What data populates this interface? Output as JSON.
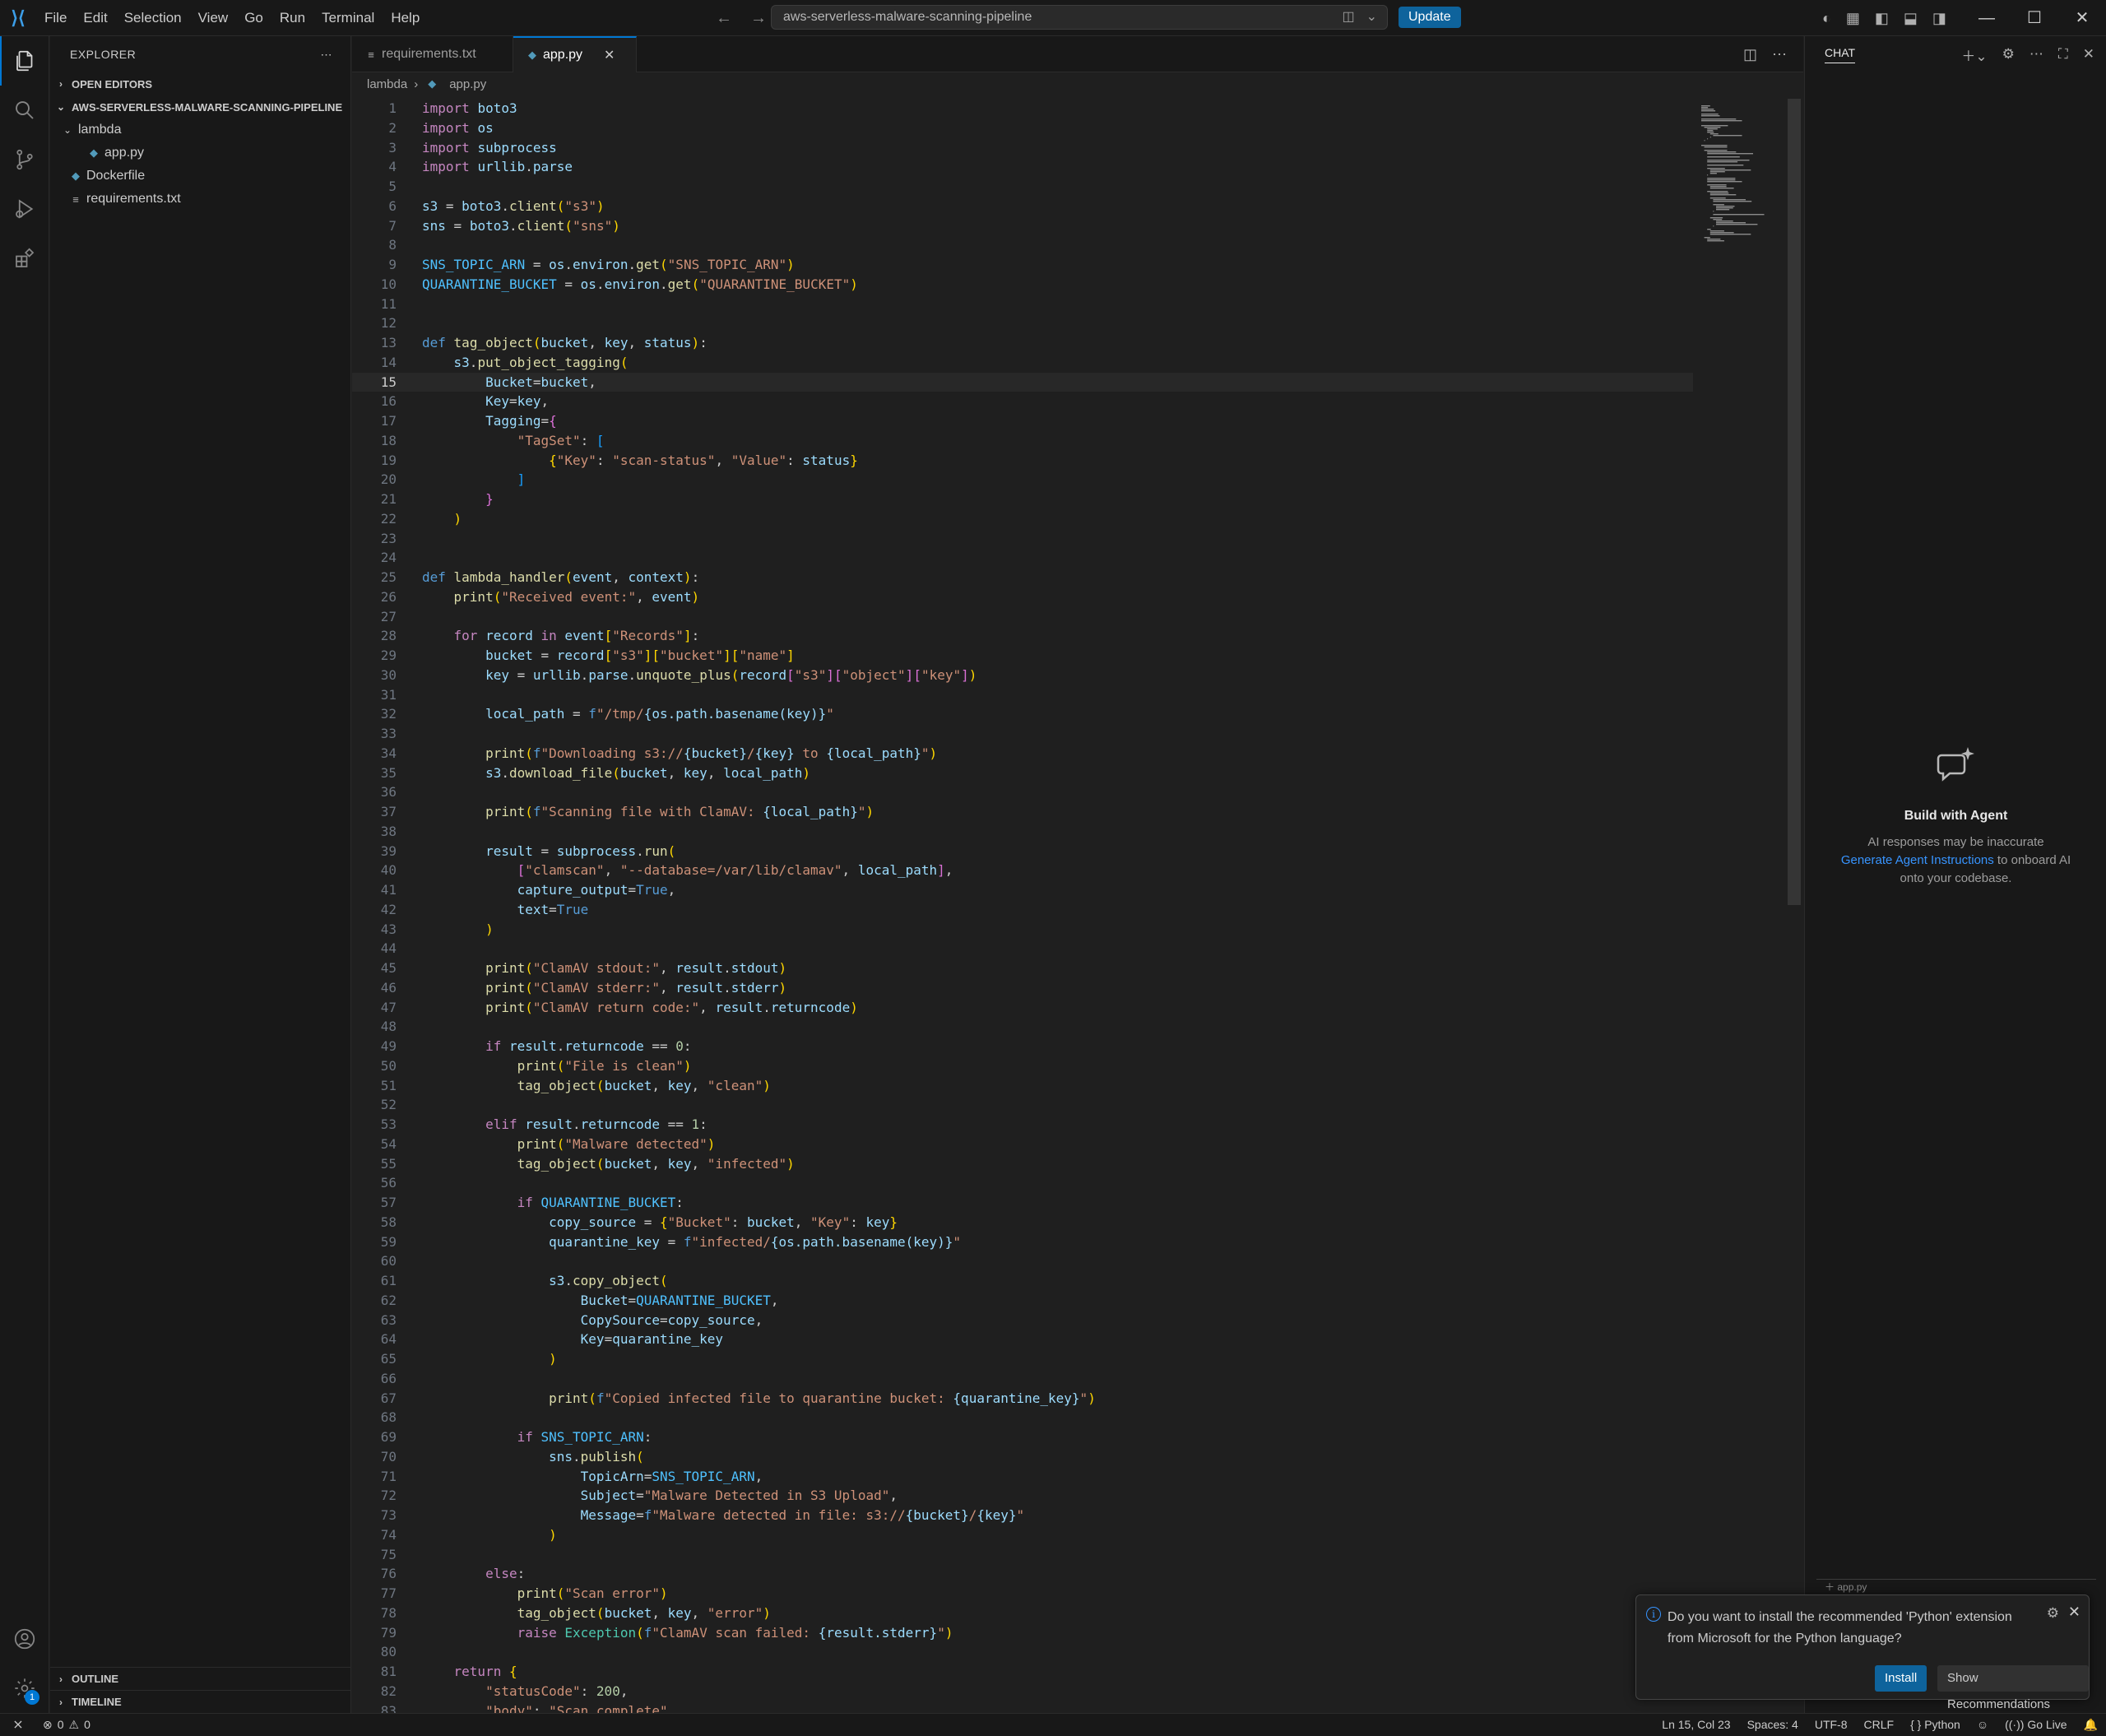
{
  "titlebar": {
    "menu": [
      "File",
      "Edit",
      "Selection",
      "View",
      "Go",
      "Run",
      "Terminal",
      "Help"
    ],
    "command_center": "aws-serverless-malware-scanning-pipeline",
    "update_label": "Update"
  },
  "activitybar": {
    "items": [
      "explorer-icon",
      "search-icon",
      "source-control-icon",
      "run-debug-icon",
      "extensions-icon"
    ],
    "settings_badge": "1"
  },
  "sidebar": {
    "header": "EXPLORER",
    "open_editors": "OPEN EDITORS",
    "project": "AWS-SERVERLESS-MALWARE-SCANNING-PIPELINE",
    "tree": [
      {
        "label": "lambda",
        "type": "folder",
        "depth": 1
      },
      {
        "label": "app.py",
        "type": "python",
        "depth": 2
      },
      {
        "label": "Dockerfile",
        "type": "docker",
        "depth": 1
      },
      {
        "label": "requirements.txt",
        "type": "text",
        "depth": 1
      }
    ],
    "outline": "OUTLINE",
    "timeline": "TIMELINE"
  },
  "editor": {
    "tabs": [
      {
        "label": "requirements.txt",
        "active": false
      },
      {
        "label": "app.py",
        "active": true
      }
    ],
    "breadcrumb": [
      "lambda",
      "app.py"
    ],
    "current_line": 15,
    "lines": [
      "import boto3",
      "import os",
      "import subprocess",
      "import urllib.parse",
      "",
      "s3 = boto3.client(\"s3\")",
      "sns = boto3.client(\"sns\")",
      "",
      "SNS_TOPIC_ARN = os.environ.get(\"SNS_TOPIC_ARN\")",
      "QUARANTINE_BUCKET = os.environ.get(\"QUARANTINE_BUCKET\")",
      "",
      "",
      "def tag_object(bucket, key, status):",
      "    s3.put_object_tagging(",
      "        Bucket=bucket,",
      "        Key=key,",
      "        Tagging={",
      "            \"TagSet\": [",
      "                {\"Key\": \"scan-status\", \"Value\": status}",
      "            ]",
      "        }",
      "    )",
      "",
      "",
      "def lambda_handler(event, context):",
      "    print(\"Received event:\", event)",
      "",
      "    for record in event[\"Records\"]:",
      "        bucket = record[\"s3\"][\"bucket\"][\"name\"]",
      "        key = urllib.parse.unquote_plus(record[\"s3\"][\"object\"][\"key\"])",
      "",
      "        local_path = f\"/tmp/{os.path.basename(key)}\"",
      "",
      "        print(f\"Downloading s3://{bucket}/{key} to {local_path}\")",
      "        s3.download_file(bucket, key, local_path)",
      "",
      "        print(f\"Scanning file with ClamAV: {local_path}\")",
      "",
      "        result = subprocess.run(",
      "            [\"clamscan\", \"--database=/var/lib/clamav\", local_path],",
      "            capture_output=True,",
      "            text=True",
      "        )",
      "",
      "        print(\"ClamAV stdout:\", result.stdout)",
      "        print(\"ClamAV stderr:\", result.stderr)",
      "        print(\"ClamAV return code:\", result.returncode)",
      "",
      "        if result.returncode == 0:",
      "            print(\"File is clean\")",
      "            tag_object(bucket, key, \"clean\")",
      "",
      "        elif result.returncode == 1:",
      "            print(\"Malware detected\")",
      "            tag_object(bucket, key, \"infected\")",
      "",
      "            if QUARANTINE_BUCKET:",
      "                copy_source = {\"Bucket\": bucket, \"Key\": key}",
      "                quarantine_key = f\"infected/{os.path.basename(key)}\"",
      "",
      "                s3.copy_object(",
      "                    Bucket=QUARANTINE_BUCKET,",
      "                    CopySource=copy_source,",
      "                    Key=quarantine_key",
      "                )",
      "",
      "                print(f\"Copied infected file to quarantine bucket: {quarantine_key}\")",
      "",
      "            if SNS_TOPIC_ARN:",
      "                sns.publish(",
      "                    TopicArn=SNS_TOPIC_ARN,",
      "                    Subject=\"Malware Detected in S3 Upload\",",
      "                    Message=f\"Malware detected in file: s3://{bucket}/{key}\"",
      "                )",
      "",
      "        else:",
      "            print(\"Scan error\")",
      "            tag_object(bucket, key, \"error\")",
      "            raise Exception(f\"ClamAV scan failed: {result.stderr}\")",
      "",
      "    return {",
      "        \"statusCode\": 200,",
      "        \"body\": \"Scan complete\""
    ]
  },
  "chat": {
    "header": "CHAT",
    "title": "Build with Agent",
    "note": "AI responses may be inaccurate",
    "link": "Generate Agent Instructions",
    "note_suffix_1": " to onboard AI",
    "note_suffix_2": "onto your codebase.",
    "input_hint": "app.py"
  },
  "notification": {
    "message": "Do you want to install the recommended 'Python' extension from Microsoft for the Python language?",
    "install_label": "Install",
    "recommendations_label": "Show Recommendations"
  },
  "statusbar": {
    "errors": "0",
    "warnings": "0",
    "position": "Ln 15, Col 23",
    "spaces": "Spaces: 4",
    "encoding": "UTF-8",
    "eol": "CRLF",
    "language": "Python",
    "golive": "Go Live"
  },
  "colors": {
    "accent": "#0078d4",
    "button": "#0e639c",
    "editor_bg": "#1f1f1f",
    "chrome_bg": "#181818"
  }
}
